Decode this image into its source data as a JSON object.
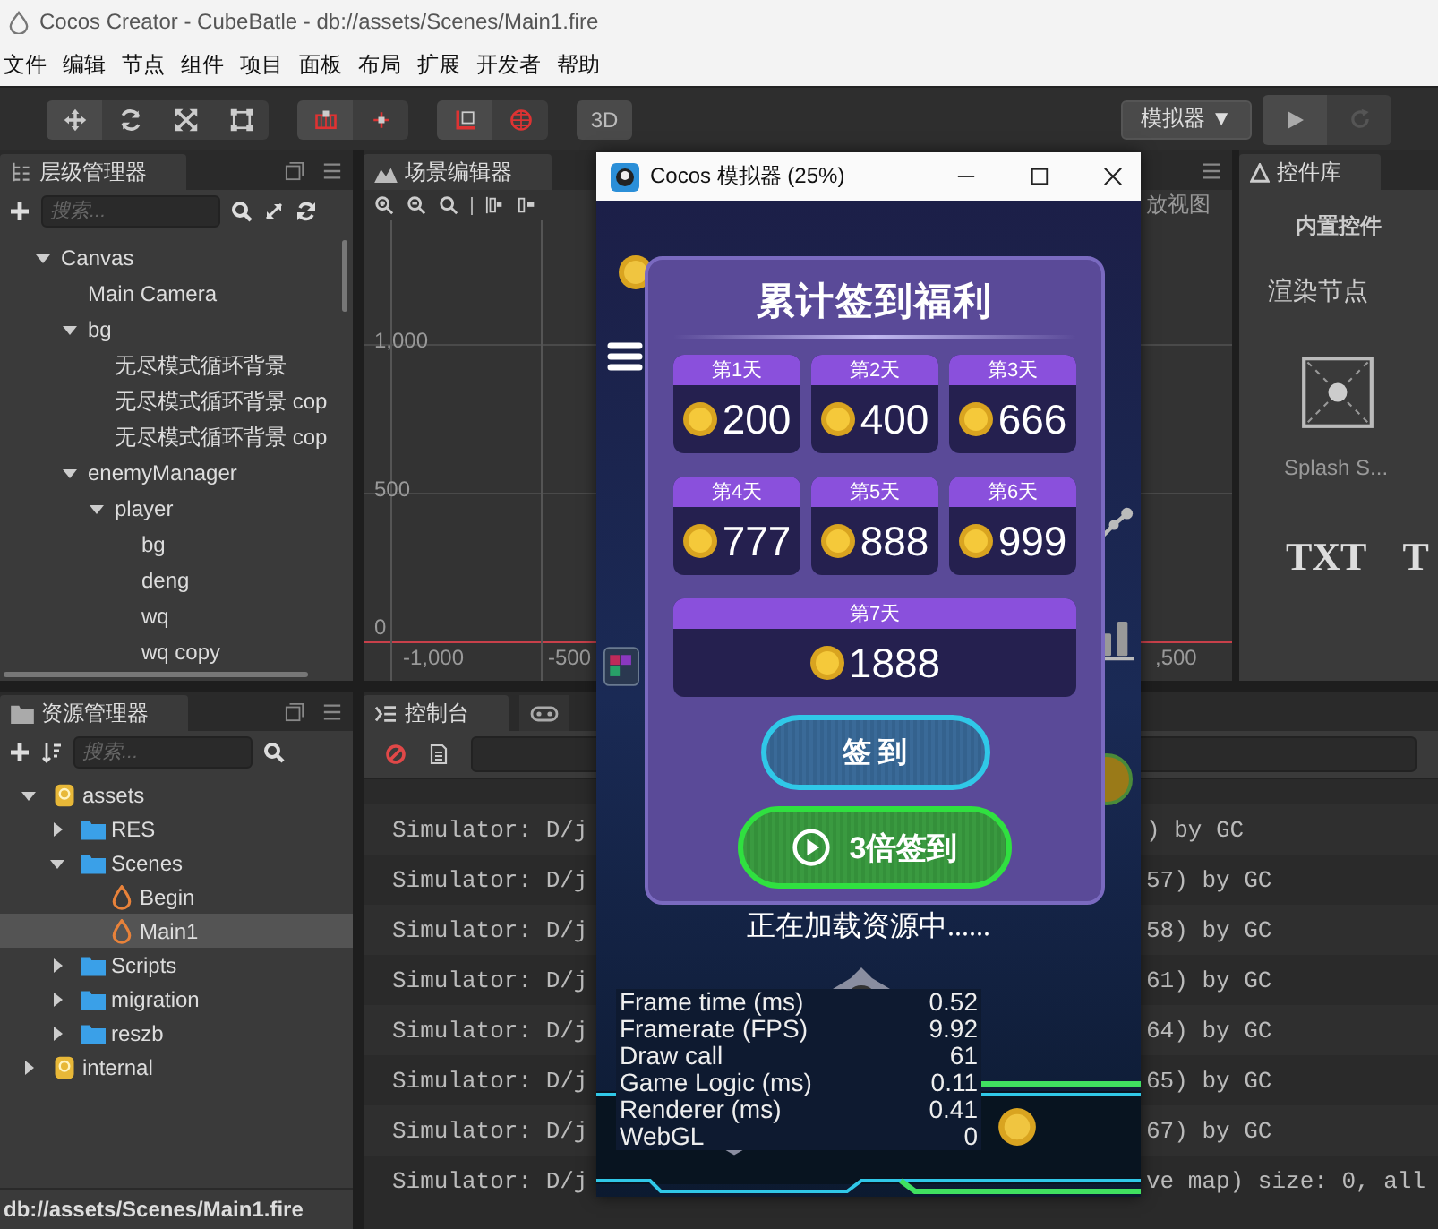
{
  "window": {
    "title": "Cocos Creator - CubeBatle - db://assets/Scenes/Main1.fire"
  },
  "menu": [
    "文件",
    "编辑",
    "节点",
    "组件",
    "项目",
    "面板",
    "布局",
    "扩展",
    "开发者",
    "帮助"
  ],
  "toolbar": {
    "mode_button": "3D",
    "platform": {
      "label": "模拟器",
      "caret": "▼"
    }
  },
  "hierarchy": {
    "title": "层级管理器",
    "search": {
      "placeholder": "搜索..."
    },
    "tree": [
      {
        "label": "Canvas",
        "expanded": true,
        "children": [
          {
            "label": "Main Camera"
          },
          {
            "label": "bg",
            "expanded": true,
            "children": [
              {
                "label": "无尽模式循环背景"
              },
              {
                "label": "无尽模式循环背景 cop"
              },
              {
                "label": "无尽模式循环背景 cop"
              }
            ]
          },
          {
            "label": "enemyManager",
            "expanded": true,
            "children": [
              {
                "label": "player",
                "expanded": true,
                "children": [
                  {
                    "label": "bg"
                  },
                  {
                    "label": "deng"
                  },
                  {
                    "label": "wq"
                  },
                  {
                    "label": "wq copy"
                  }
                ]
              }
            ]
          }
        ]
      }
    ]
  },
  "scene_editor": {
    "title": "场景编辑器",
    "zoom_label": "放视图",
    "y_labels": [
      "1,000",
      "500",
      "0"
    ],
    "x_labels": [
      "-1,000",
      "-500",
      ",500"
    ]
  },
  "widget_library": {
    "title": "控件库",
    "section": "内置控件",
    "category": "渲染节点",
    "sprite_caption": "Splash S...",
    "text_items": [
      "TXT",
      "T"
    ]
  },
  "assets": {
    "title": "资源管理器",
    "search": {
      "placeholder": "搜索..."
    },
    "tree": [
      {
        "label": "assets",
        "kind": "db",
        "expanded": true,
        "selected": false,
        "children": [
          {
            "label": "RES",
            "kind": "folder",
            "expanded": false,
            "selected": false
          },
          {
            "label": "Scenes",
            "kind": "folder",
            "expanded": true,
            "selected": false,
            "children": [
              {
                "label": "Begin",
                "kind": "scene",
                "selected": false
              },
              {
                "label": "Main1",
                "kind": "scene",
                "selected": true
              }
            ]
          },
          {
            "label": "Scripts",
            "kind": "folder",
            "expanded": false,
            "selected": false
          },
          {
            "label": "migration",
            "kind": "folder",
            "expanded": false,
            "selected": false
          },
          {
            "label": "reszb",
            "kind": "folder",
            "expanded": false,
            "selected": false
          }
        ]
      },
      {
        "label": "internal",
        "kind": "db",
        "expanded": false,
        "selected": false
      }
    ],
    "status_bar": "db://assets/Scenes/Main1.fire"
  },
  "console": {
    "title": "控制台",
    "lines": [
      {
        "start": "Simulator: D/j",
        "end": ") by GC"
      },
      {
        "start": "Simulator: D/j",
        "end": "57) by GC"
      },
      {
        "start": "Simulator: D/j",
        "end": "58) by GC"
      },
      {
        "start": "Simulator: D/j",
        "end": "61) by GC"
      },
      {
        "start": "Simulator: D/j",
        "end": "64) by GC"
      },
      {
        "start": "Simulator: D/j",
        "end": "65) by GC"
      },
      {
        "start": "Simulator: D/j",
        "end": "67) by GC"
      },
      {
        "start": "Simulator: D/j",
        "end": "ve map) size: 0, all"
      }
    ]
  },
  "simulator": {
    "title": "Cocos 模拟器 (25%)",
    "dialog": {
      "title": "累计签到福利",
      "days": [
        {
          "label": "第1天",
          "amount": "200"
        },
        {
          "label": "第2天",
          "amount": "400"
        },
        {
          "label": "第3天",
          "amount": "666"
        },
        {
          "label": "第4天",
          "amount": "777"
        },
        {
          "label": "第5天",
          "amount": "888"
        },
        {
          "label": "第6天",
          "amount": "999"
        },
        {
          "label": "第7天",
          "amount": "1888"
        }
      ],
      "sign_button": "签 到",
      "triple_button": "3倍签到"
    },
    "loading_text": "正在加载资源中......",
    "stats": [
      {
        "label": "Frame time (ms)",
        "value": "0.52"
      },
      {
        "label": "Framerate (FPS)",
        "value": "9.92"
      },
      {
        "label": "Draw call",
        "value": "61"
      },
      {
        "label": "Game Logic (ms)",
        "value": "0.11"
      },
      {
        "label": "Renderer (ms)",
        "value": "0.41"
      },
      {
        "label": "WebGL",
        "value": "0"
      }
    ]
  }
}
